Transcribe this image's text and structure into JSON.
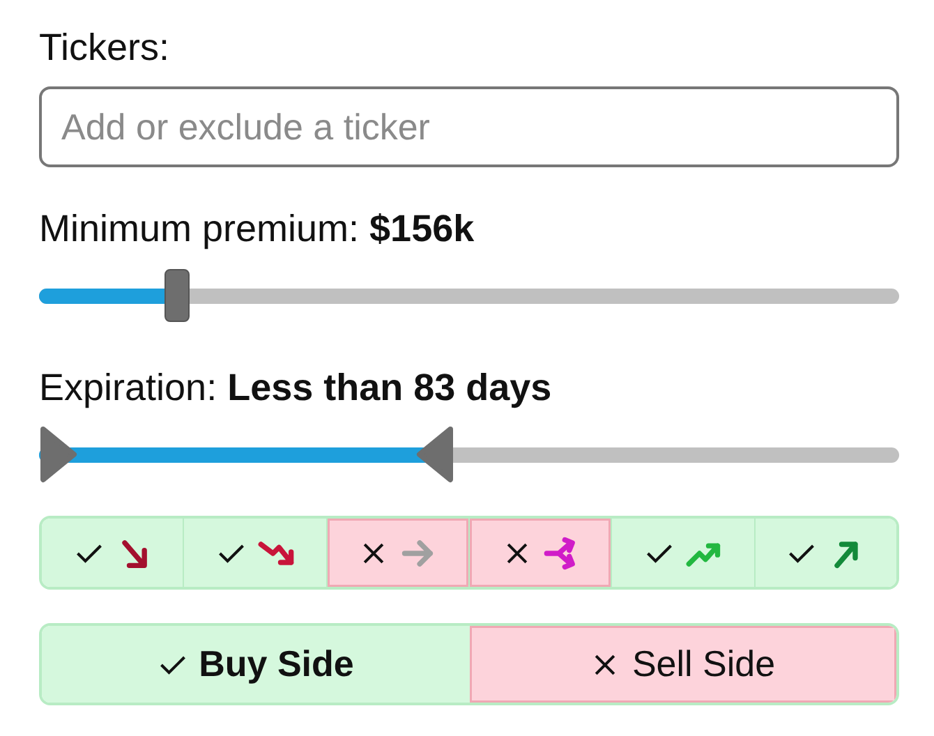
{
  "tickers": {
    "label": "Tickers:",
    "placeholder": "Add or exclude a ticker"
  },
  "premium": {
    "label": "Minimum premium: ",
    "value": "$156k",
    "level": 0.16
  },
  "expiration": {
    "label": "Expiration: ",
    "value": "Less than 83 days",
    "level": 0.46
  },
  "filters": [
    {
      "kind": "arrow-down",
      "color": "#a3102e",
      "on": true
    },
    {
      "kind": "trend-down",
      "color": "#c8143a",
      "on": true
    },
    {
      "kind": "arrow-right",
      "color": "#a0a0a0",
      "on": false
    },
    {
      "kind": "split",
      "color": "#d01cc8",
      "on": false
    },
    {
      "kind": "trend-up",
      "color": "#22b840",
      "on": true
    },
    {
      "kind": "arrow-up",
      "color": "#138a3a",
      "on": true
    }
  ],
  "sides": [
    {
      "label": "Buy Side",
      "on": true
    },
    {
      "label": "Sell Side",
      "on": false
    }
  ]
}
